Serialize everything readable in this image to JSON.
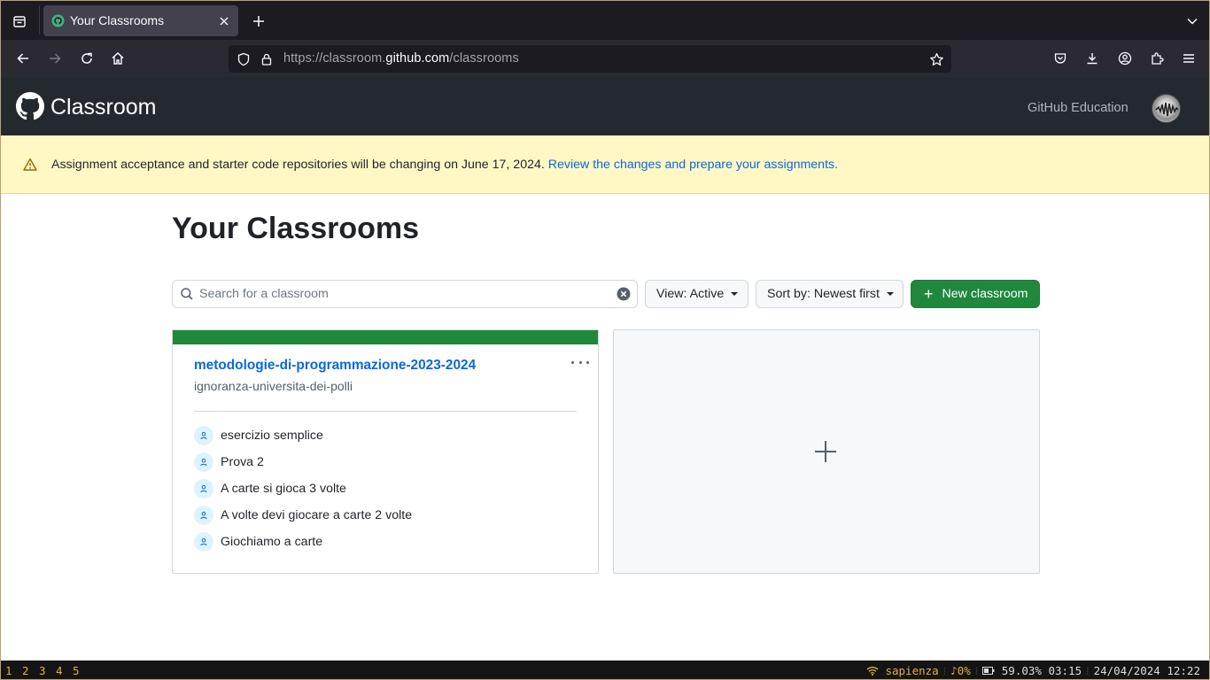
{
  "browser": {
    "tab": {
      "title": "Your Classrooms"
    },
    "url": {
      "prefix": "https://classroom.",
      "domain": "github.com",
      "path": "/classrooms"
    }
  },
  "header": {
    "brand": "Classroom",
    "education_link": "GitHub Education"
  },
  "flash": {
    "message": "Assignment acceptance and starter code repositories will be changing on June 17, 2024. ",
    "link": "Review the changes and prepare your assignments."
  },
  "main": {
    "title": "Your Classrooms",
    "search": {
      "placeholder": "Search for a classroom",
      "value": ""
    },
    "view_button": "View: Active",
    "sort_button": "Sort by: Newest first",
    "new_button": "New classroom"
  },
  "classroom": {
    "name": "metodologie-di-programmazione-2023-2024",
    "org": "ignoranza-universita-dei-polli",
    "accent_color": "#1f883d",
    "assignments": [
      {
        "label": "esercizio semplice"
      },
      {
        "label": "Prova 2"
      },
      {
        "label": "A carte si gioca 3 volte"
      },
      {
        "label": "A volte devi giocare a carte 2 volte"
      },
      {
        "label": "Giochiamo a carte"
      }
    ]
  },
  "statusbar": {
    "workspaces": [
      "1",
      "2",
      "3",
      "4",
      "5"
    ],
    "wifi": "sapienza",
    "volume": "0%",
    "battery": "59.03% 03:15",
    "datetime": "24/04/2024 12:22"
  },
  "colors": {
    "link": "#0969da",
    "primary_button": "#1f883d",
    "header_bg": "#24292f",
    "flash_bg": "#fff8c5"
  }
}
